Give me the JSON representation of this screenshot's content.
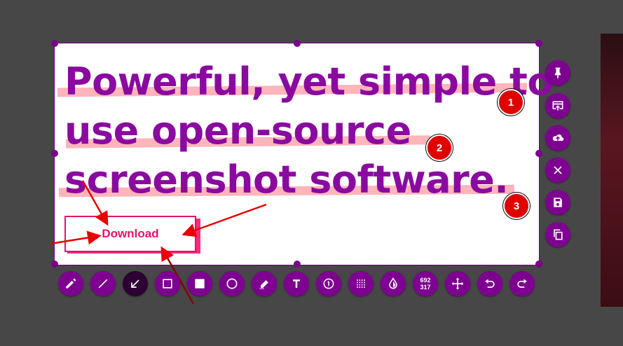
{
  "headline": {
    "line1": "Powerful, yet simple to",
    "line2": "use open-source",
    "line3": "screenshot software."
  },
  "badges": [
    "1",
    "2",
    "3"
  ],
  "download_label": "Download",
  "selection_size": {
    "width": "692",
    "height": "317"
  },
  "colors": {
    "accent": "#7d0090",
    "headline": "#8a0aa0",
    "marker": "#ff7882",
    "badge": "#e00000",
    "arrow": "#e60000",
    "download": "#e0136c"
  },
  "toolbar_bottom": [
    "pencil-icon",
    "line-icon",
    "arrow-icon",
    "rectangle-outline-icon",
    "rectangle-filled-icon",
    "circle-icon",
    "marker-icon",
    "text-icon",
    "counter-icon",
    "pixelate-icon",
    "color-picker-icon",
    "size-indicator",
    "move-icon",
    "undo-icon",
    "redo-icon"
  ],
  "toolbar_side": [
    "pin-icon",
    "open-app-icon",
    "upload-icon",
    "close-icon",
    "save-icon",
    "copy-icon"
  ]
}
